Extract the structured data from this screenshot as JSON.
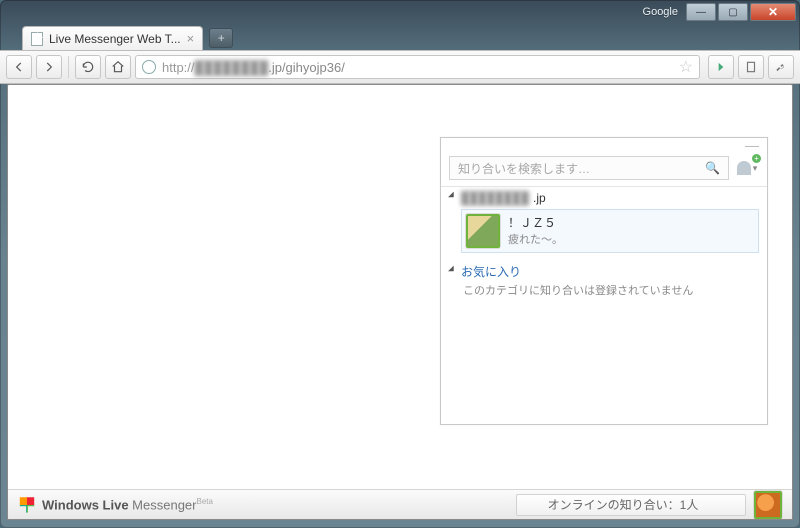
{
  "window": {
    "logo": "Google"
  },
  "tab": {
    "title": "Live Messenger Web T..."
  },
  "url": {
    "prefix": "http://",
    "hidden": "████████",
    "suffix": ".jp/gihyojp36/"
  },
  "messenger": {
    "search_placeholder": "知り合いを検索します…",
    "group1": {
      "label_hidden": "████████",
      "label_suffix": ".jp"
    },
    "contact": {
      "name": "！ＪＺ５",
      "status": "疲れた～。"
    },
    "favorites": {
      "label": "お気に入り",
      "empty": "このカテゴリに知り合いは登録されていません"
    }
  },
  "bottombar": {
    "brand_bold": "Windows Live",
    "brand_thin": " Messenger",
    "brand_beta": "Beta",
    "online_label": "オンラインの知り合い：",
    "online_count": "1",
    "online_unit": " 人"
  }
}
